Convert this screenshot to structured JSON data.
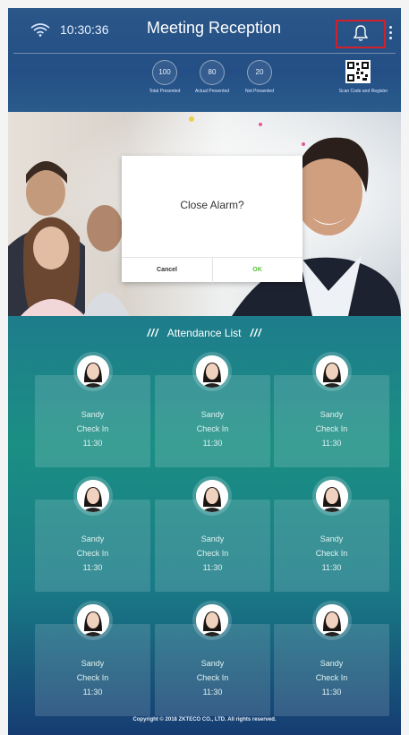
{
  "status_bar": {
    "time": "10:30:36"
  },
  "header": {
    "title": "Meeting Reception"
  },
  "stats": [
    {
      "value": "100",
      "label": "Total Presented"
    },
    {
      "value": "80",
      "label": "Actual Presented"
    },
    {
      "value": "20",
      "label": "Not Presented"
    }
  ],
  "qr": {
    "label": "Scan Code and Register"
  },
  "dialog": {
    "message": "Close Alarm?",
    "cancel_label": "Cancel",
    "ok_label": "OK"
  },
  "attendance": {
    "slashes": "///",
    "title": "Attendance List",
    "cards": [
      {
        "name": "Sandy",
        "status": "Check In",
        "time": "11:30"
      },
      {
        "name": "Sandy",
        "status": "Check In",
        "time": "11:30"
      },
      {
        "name": "Sandy",
        "status": "Check In",
        "time": "11:30"
      },
      {
        "name": "Sandy",
        "status": "Check In",
        "time": "11:30"
      },
      {
        "name": "Sandy",
        "status": "Check In",
        "time": "11:30"
      },
      {
        "name": "Sandy",
        "status": "Check In",
        "time": "11:30"
      },
      {
        "name": "Sandy",
        "status": "Check In",
        "time": "11:30"
      },
      {
        "name": "Sandy",
        "status": "Check In",
        "time": "11:30"
      },
      {
        "name": "Sandy",
        "status": "Check In",
        "time": "11:30"
      }
    ]
  },
  "footer": {
    "copyright": "Copyright © 2018 ZKTECO CO., LTD. All rights reserved."
  },
  "colors": {
    "accent_ok": "#5bbf3a",
    "highlight": "#d0202a"
  },
  "icons": [
    "wifi-icon",
    "bell-icon",
    "more-icon",
    "qr-code-icon"
  ]
}
